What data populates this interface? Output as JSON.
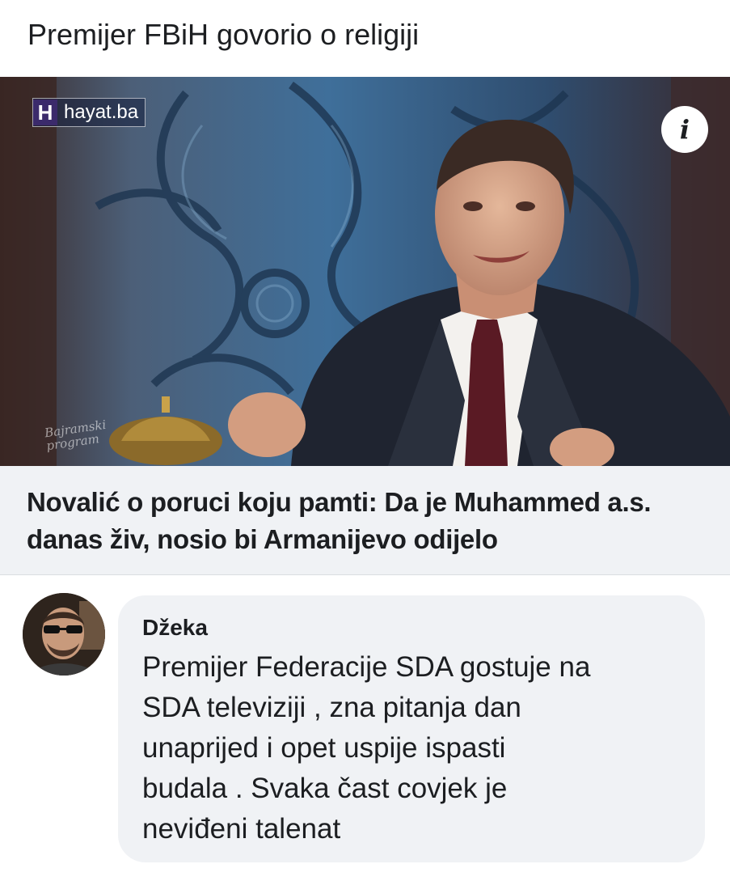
{
  "post": {
    "title": "Premijer FBiH govorio o religiji"
  },
  "media": {
    "brand_logo": "H",
    "brand_text": "hayat.ba",
    "info_icon": "i",
    "watermark": "Bajramski\nprogram"
  },
  "link": {
    "headline": "Novalić o poruci koju pamti: Da je Muhammed a.s. danas živ, nosio bi Armanijevo odijelo"
  },
  "comment": {
    "author": "Džeka",
    "text": "Premijer Federacije SDA gostuje na\nSDA televiziji , zna  pitanja dan\nunaprijed  i opet uspije ispasti\nbudala . Svaka čast covjek je\nneviđeni talenat"
  }
}
